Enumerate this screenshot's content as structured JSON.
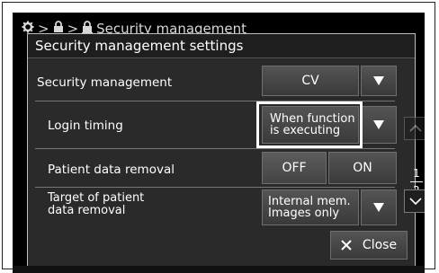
{
  "breadcrumb": {
    "items": [
      "Security management"
    ]
  },
  "dialog": {
    "title": "Security management settings",
    "rows": [
      {
        "label": "Security management",
        "value": "CV"
      },
      {
        "label": "Login timing",
        "value_line1": "When function",
        "value_line2": "is executing"
      },
      {
        "label": "Patient data removal",
        "off_label": "OFF",
        "on_label": "ON",
        "selected": "OFF"
      },
      {
        "label_line1": "Target of patient",
        "label_line2": "data removal",
        "value_line1": "Internal mem.",
        "value_line2": "Images only"
      }
    ],
    "page": {
      "current": "1",
      "total": "2"
    },
    "close_label": "Close"
  },
  "colors": {
    "screen_bg": "#000000",
    "dialog_bg": "#2a2a2a",
    "button_bg": "#4a4a4a",
    "text": "#ffffff",
    "highlight": "#ffffff"
  },
  "icons": [
    "gear-icon",
    "lock-icon",
    "lock-user-icon",
    "dropdown-arrow-icon",
    "scroll-up-icon",
    "scroll-down-icon",
    "close-x-icon"
  ]
}
